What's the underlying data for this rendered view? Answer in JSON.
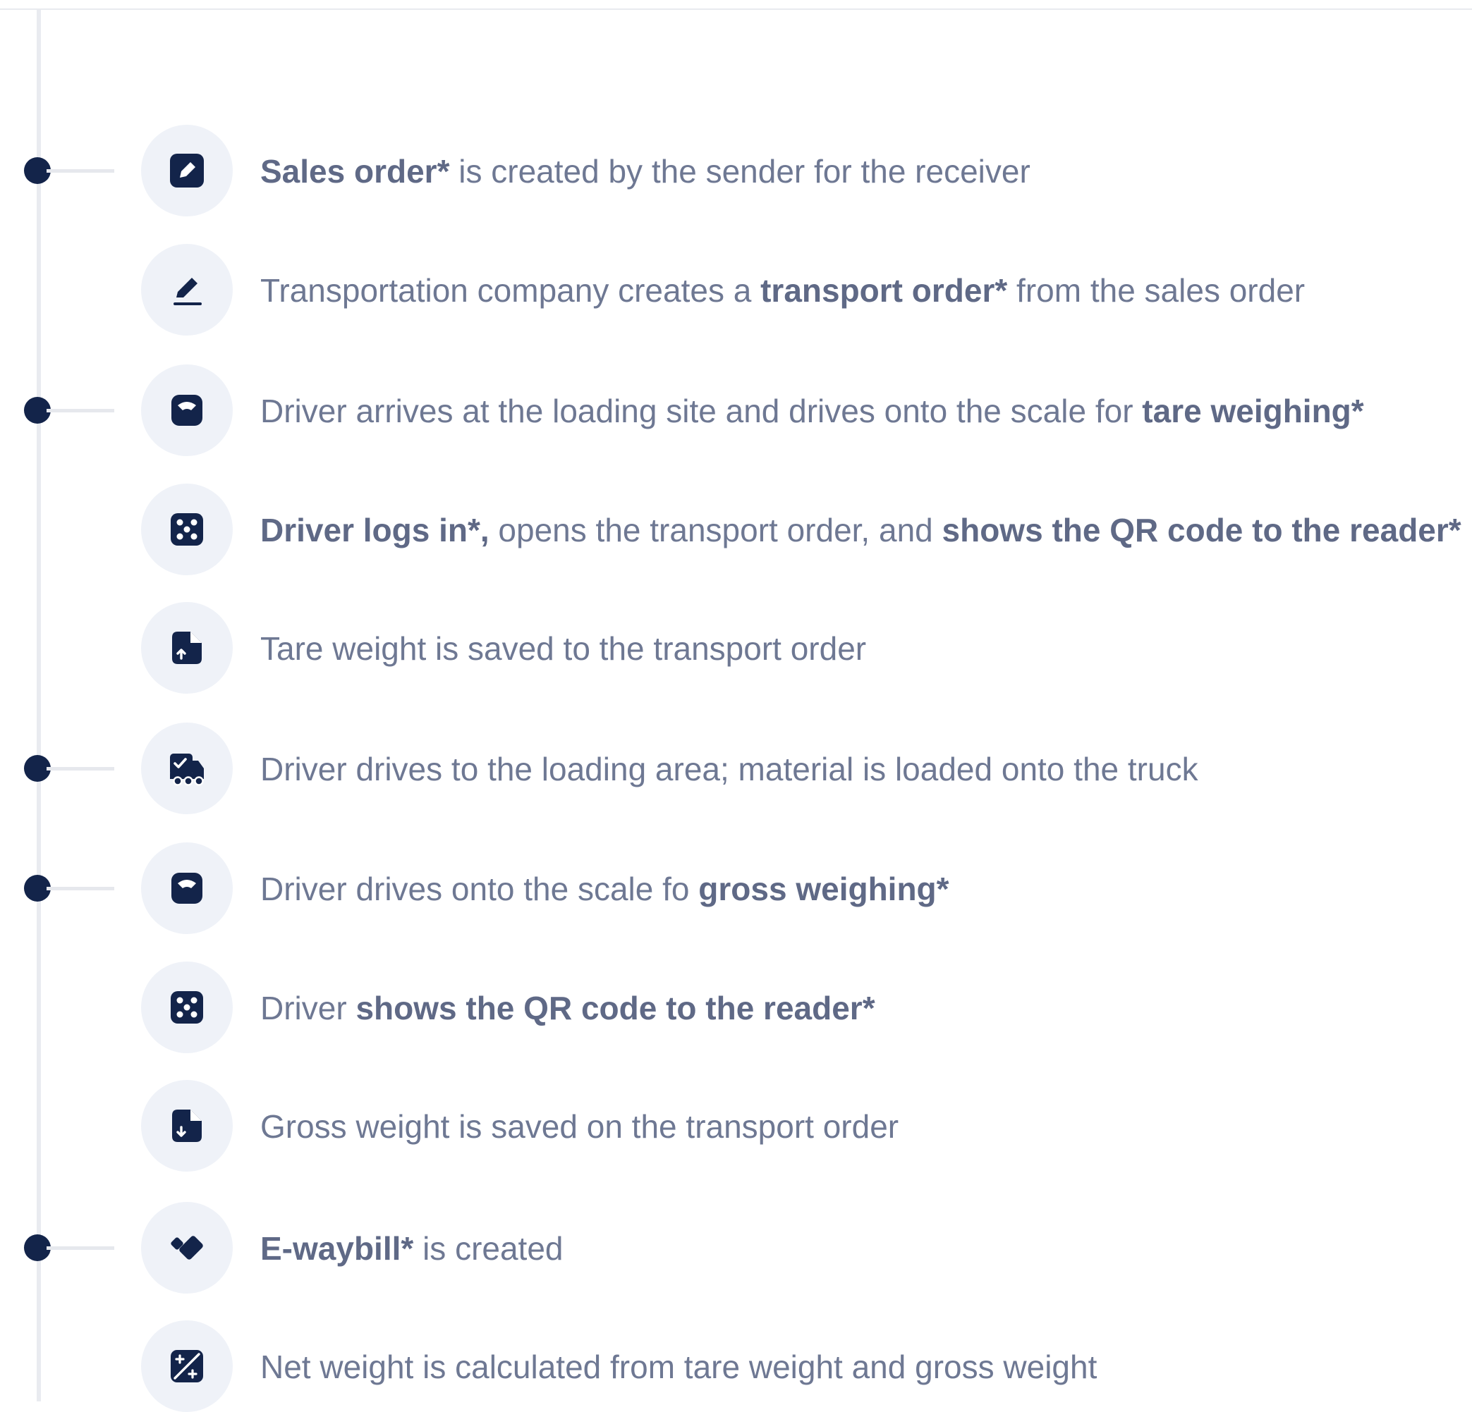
{
  "colors": {
    "dot": "#13244a",
    "icon": "#13244a",
    "badge_bg": "#eff2f8",
    "rail": "#e9ebf0",
    "text": "#6e7893",
    "text_bold": "#5f6986"
  },
  "steps": [
    {
      "icon": "edit-square-icon",
      "dot": true,
      "parts": [
        {
          "text": "Sales order*",
          "bold": true
        },
        {
          "text": " is created by the sender for the receiver",
          "bold": false
        }
      ]
    },
    {
      "icon": "pen-sign-icon",
      "dot": false,
      "parts": [
        {
          "text": "Transportation company creates a ",
          "bold": false
        },
        {
          "text": "transport order*",
          "bold": true
        },
        {
          "text": " from the sales order",
          "bold": false
        }
      ]
    },
    {
      "icon": "scale-icon",
      "dot": true,
      "parts": [
        {
          "text": "Driver arrives at the loading site and drives onto the scale for ",
          "bold": false
        },
        {
          "text": "tare weighing*",
          "bold": true
        }
      ]
    },
    {
      "icon": "qr-code-icon",
      "dot": false,
      "parts": [
        {
          "text": "Driver logs in*,",
          "bold": true
        },
        {
          "text": " opens the transport order, and ",
          "bold": false
        },
        {
          "text": "shows the QR code to the reader*",
          "bold": true
        }
      ]
    },
    {
      "icon": "file-upload-icon",
      "dot": false,
      "parts": [
        {
          "text": "Tare weight is saved to the transport order",
          "bold": false
        }
      ]
    },
    {
      "icon": "truck-loaded-icon",
      "dot": true,
      "parts": [
        {
          "text": "Driver drives to the loading area; material is loaded onto the truck",
          "bold": false
        }
      ]
    },
    {
      "icon": "scale-icon",
      "dot": true,
      "parts": [
        {
          "text": "Driver drives onto the scale fo ",
          "bold": false
        },
        {
          "text": "gross weighing*",
          "bold": true
        }
      ]
    },
    {
      "icon": "qr-code-icon",
      "dot": false,
      "parts": [
        {
          "text": "Driver ",
          "bold": false
        },
        {
          "text": "shows the QR code to the reader*",
          "bold": true
        }
      ]
    },
    {
      "icon": "file-download-icon",
      "dot": false,
      "parts": [
        {
          "text": "Gross weight is saved on the transport order",
          "bold": false
        }
      ]
    },
    {
      "icon": "ticket-icon",
      "dot": true,
      "parts": [
        {
          "text": "E-waybill*",
          "bold": true
        },
        {
          "text": " is created",
          "bold": false
        }
      ]
    },
    {
      "icon": "calculator-icon",
      "dot": false,
      "parts": [
        {
          "text": "Net weight is calculated from tare weight and gross weight",
          "bold": false
        }
      ]
    }
  ]
}
